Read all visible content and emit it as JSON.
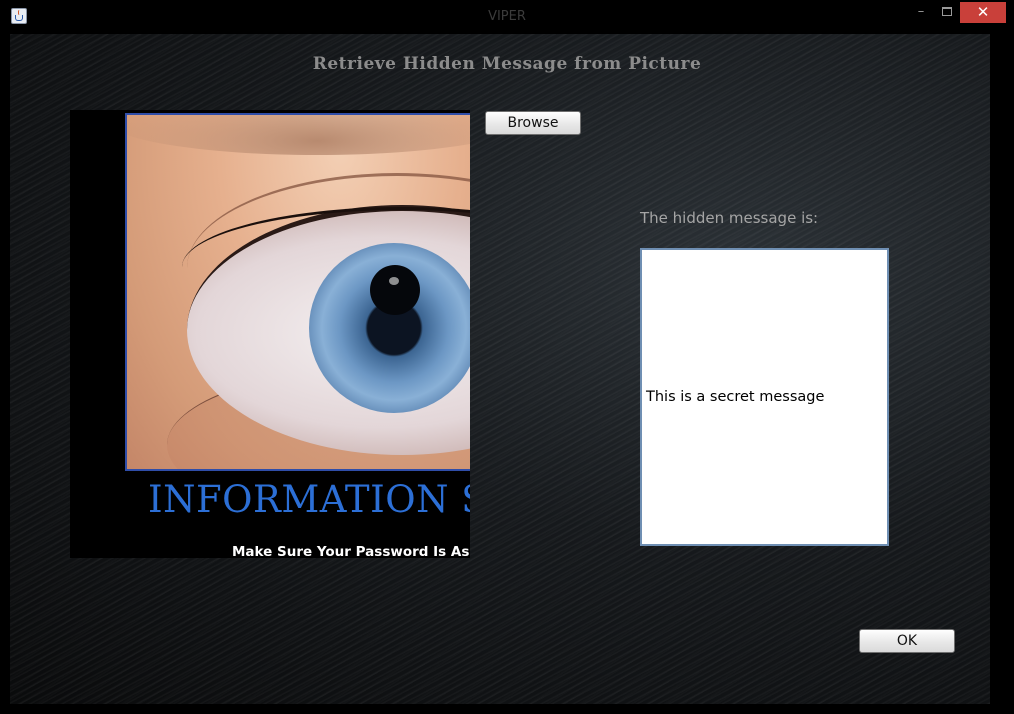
{
  "window": {
    "title": "VIPER",
    "controls": {
      "minimize": "–",
      "maximize": "",
      "close": "✕"
    },
    "app_icon": "java-cup-icon"
  },
  "heading": "Retrieve Hidden Message from Picture",
  "image": {
    "banner_title": "INFORMATION SE",
    "banner_subtitle": "Make Sure Your Password Is As Uni",
    "description": "eye-photo"
  },
  "buttons": {
    "browse_label": "Browse",
    "ok_label": "OK"
  },
  "result": {
    "label": "The hidden message is:",
    "message": "This is a secret message"
  },
  "colors": {
    "close_button": "#c9403a",
    "banner_title": "#2c6fd6",
    "heading": "#8c8c8c"
  }
}
